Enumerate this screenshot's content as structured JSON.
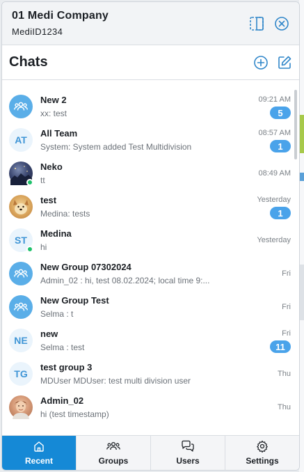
{
  "company": {
    "name": "01 Medi Company",
    "id": "MediID1234"
  },
  "chats_header": {
    "title": "Chats"
  },
  "chats": [
    {
      "name": "New 2",
      "preview": "xx: test",
      "time": "09:21 AM",
      "badge": "5",
      "avatar": "group-icon",
      "initials": "",
      "online": false
    },
    {
      "name": "All Team",
      "preview": "System: System added Test Multidivision",
      "time": "08:57 AM",
      "badge": "1",
      "avatar": "initials",
      "initials": "AT",
      "online": false
    },
    {
      "name": "Neko",
      "preview": "tt",
      "time": "08:49 AM",
      "badge": "",
      "avatar": "photo",
      "initials": "",
      "online": true
    },
    {
      "name": "test",
      "preview": "Medina: tests",
      "time": "Yesterday",
      "badge": "1",
      "avatar": "photo",
      "initials": "",
      "online": false
    },
    {
      "name": "Medina",
      "preview": "hi",
      "time": "Yesterday",
      "badge": "",
      "avatar": "initials",
      "initials": "ST",
      "online": true
    },
    {
      "name": "New Group 07302024",
      "preview": "Admin_02 : hi, test 08.02.2024; local time 9:...",
      "time": "Fri",
      "badge": "",
      "avatar": "group-icon",
      "initials": "",
      "online": false
    },
    {
      "name": "New Group Test",
      "preview": "Selma : t",
      "time": "Fri",
      "badge": "",
      "avatar": "group-icon",
      "initials": "",
      "online": false
    },
    {
      "name": "new",
      "preview": "Selma : test",
      "time": "Fri",
      "badge": "11",
      "avatar": "initials",
      "initials": "NE",
      "online": false
    },
    {
      "name": "test group 3",
      "preview": "MDUser MDUser: test multi division user",
      "time": "Thu",
      "badge": "",
      "avatar": "initials",
      "initials": "TG",
      "online": false
    },
    {
      "name": "Admin_02",
      "preview": "hi (test timestamp)",
      "time": "Thu",
      "badge": "",
      "avatar": "photo",
      "initials": "",
      "online": false
    }
  ],
  "tabs": [
    {
      "label": "Recent",
      "icon": "home-icon",
      "active": true
    },
    {
      "label": "Groups",
      "icon": "groups-icon",
      "active": false
    },
    {
      "label": "Users",
      "icon": "chat-bubbles-icon",
      "active": false
    },
    {
      "label": "Settings",
      "icon": "gear-icon",
      "active": false
    }
  ],
  "colors": {
    "accent": "#1589d6",
    "badge": "#4aa3ea",
    "online": "#1fc16b"
  }
}
